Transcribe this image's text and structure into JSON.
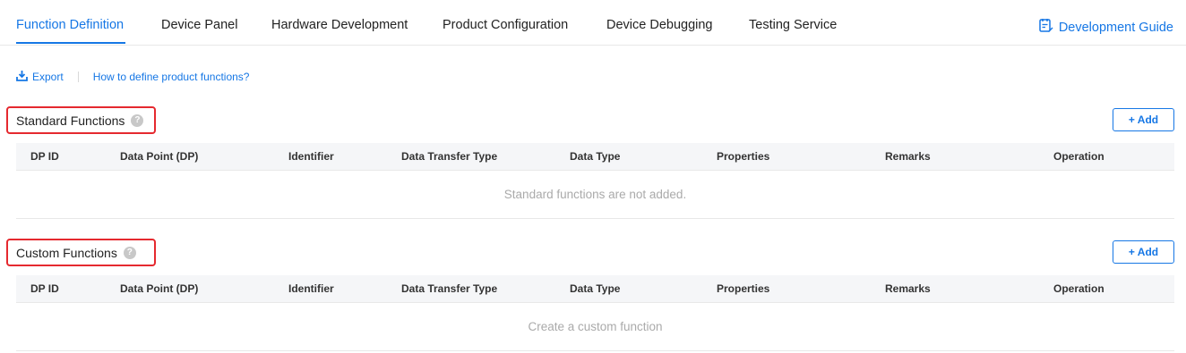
{
  "tabs": [
    {
      "label": "Function Definition",
      "active": true
    },
    {
      "label": "Device Panel"
    },
    {
      "label": "Hardware Development"
    },
    {
      "label": "Product Configuration"
    },
    {
      "label": "Device Debugging"
    },
    {
      "label": "Testing Service"
    }
  ],
  "header": {
    "guide_label": "Development Guide"
  },
  "toolbar": {
    "export_label": "Export",
    "help_link": "How to define product functions?"
  },
  "columns": [
    "DP ID",
    "Data Point (DP)",
    "Identifier",
    "Data Transfer Type",
    "Data Type",
    "Properties",
    "Remarks",
    "Operation"
  ],
  "standard": {
    "title": "Standard Functions",
    "add_label": "+ Add",
    "empty_text": "Standard functions are not added."
  },
  "custom": {
    "title": "Custom Functions",
    "add_label": "+ Add",
    "empty_text": "Create a custom function"
  },
  "colors": {
    "accent": "#1677e5",
    "highlight": "#e5292f"
  }
}
